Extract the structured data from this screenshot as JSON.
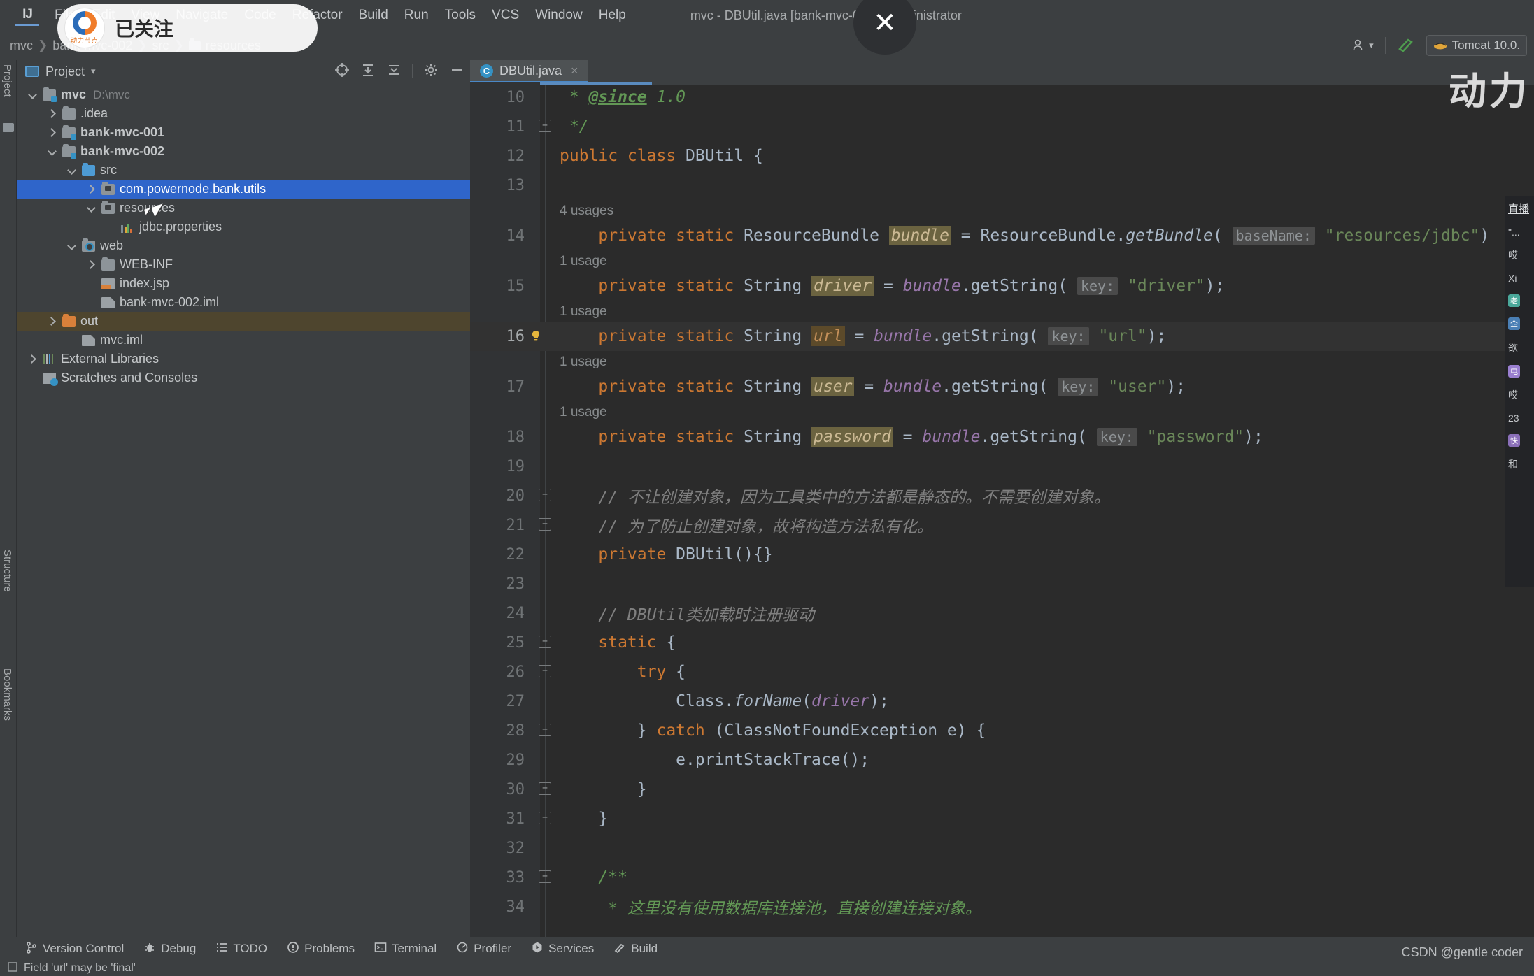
{
  "window": {
    "title": "mvc - DBUtil.java [bank-mvc-002] - Administrator",
    "logo_text": "IJ"
  },
  "menu": {
    "items": [
      "File",
      "Edit",
      "View",
      "Navigate",
      "Code",
      "Refactor",
      "Build",
      "Run",
      "Tools",
      "VCS",
      "Window",
      "Help"
    ]
  },
  "breadcrumb": {
    "items": [
      "mvc",
      "bank-mvc-002",
      "src",
      "resources"
    ]
  },
  "toolbar_right": {
    "account_icon": "user-icon",
    "hammer_icon": "build-icon",
    "run_config": "Tomcat 10.0."
  },
  "rails": {
    "left_top": "Project",
    "left_mid": "Structure",
    "left_bottom": "Bookmarks"
  },
  "project_panel": {
    "title": "Project",
    "icons": [
      "target-icon",
      "collapse-all-icon",
      "expand-icon",
      "gear-icon",
      "minimize-icon"
    ],
    "tree": [
      {
        "label": "mvc",
        "path": "D:\\mvc",
        "indent": 0,
        "arrow": "down",
        "icon": "module",
        "bold": true
      },
      {
        "label": ".idea",
        "path": "",
        "indent": 1,
        "arrow": "right",
        "icon": "folder",
        "bold": false
      },
      {
        "label": "bank-mvc-001",
        "path": "",
        "indent": 1,
        "arrow": "right",
        "icon": "module",
        "bold": true
      },
      {
        "label": "bank-mvc-002",
        "path": "",
        "indent": 1,
        "arrow": "down",
        "icon": "module",
        "bold": true
      },
      {
        "label": "src",
        "path": "",
        "indent": 2,
        "arrow": "down",
        "icon": "source",
        "bold": false
      },
      {
        "label": "com.powernode.bank.utils",
        "path": "",
        "indent": 3,
        "arrow": "right",
        "icon": "package",
        "bold": false,
        "selected": true
      },
      {
        "label": "resources",
        "path": "",
        "indent": 3,
        "arrow": "down",
        "icon": "resource",
        "bold": false
      },
      {
        "label": "jdbc.properties",
        "path": "",
        "indent": 4,
        "arrow": "none",
        "icon": "properties",
        "bold": false
      },
      {
        "label": "web",
        "path": "",
        "indent": 2,
        "arrow": "down",
        "icon": "webfolder",
        "bold": false
      },
      {
        "label": "WEB-INF",
        "path": "",
        "indent": 3,
        "arrow": "right",
        "icon": "folder",
        "bold": false
      },
      {
        "label": "index.jsp",
        "path": "",
        "indent": 3,
        "arrow": "none",
        "icon": "jsp",
        "bold": false
      },
      {
        "label": "bank-mvc-002.iml",
        "path": "",
        "indent": 3,
        "arrow": "none",
        "icon": "iml",
        "bold": false
      },
      {
        "label": "out",
        "path": "",
        "indent": 1,
        "arrow": "right",
        "icon": "out",
        "bold": false,
        "excluded": true
      },
      {
        "label": "mvc.iml",
        "path": "",
        "indent": 2,
        "arrow": "none",
        "icon": "iml",
        "bold": false
      },
      {
        "label": "External Libraries",
        "path": "",
        "indent": 0,
        "arrow": "right",
        "icon": "library",
        "bold": false
      },
      {
        "label": "Scratches and Consoles",
        "path": "",
        "indent": 0,
        "arrow": "none",
        "icon": "scratch",
        "bold": false
      }
    ]
  },
  "editor": {
    "tab": {
      "name": "DBUtil.java",
      "icon_letter": "C",
      "close": "×"
    },
    "lines": [
      {
        "num": "10",
        "fold": "",
        "segments": [
          {
            "t": " * ",
            "c": "doc"
          },
          {
            "t": "@since",
            "c": "doctag"
          },
          {
            "t": " 1.0",
            "c": "doc"
          }
        ]
      },
      {
        "num": "11",
        "fold": "minus",
        "segments": [
          {
            "t": " */",
            "c": "doc"
          }
        ]
      },
      {
        "num": "12",
        "fold": "",
        "segments": [
          {
            "t": "public class ",
            "c": "kw"
          },
          {
            "t": "DBUtil",
            "c": "cls"
          },
          {
            "t": " {",
            "c": "plain"
          }
        ]
      },
      {
        "num": "13",
        "fold": "",
        "segments": []
      },
      {
        "num": "14",
        "fold": "",
        "hint": "4 usages",
        "segments": [
          {
            "t": "    private static ",
            "c": "kw"
          },
          {
            "t": "ResourceBundle ",
            "c": "cls"
          },
          {
            "t": "bundle",
            "c": "fldhl"
          },
          {
            "t": " = ",
            "c": "plain"
          },
          {
            "t": "ResourceBundle.",
            "c": "plain"
          },
          {
            "t": "getBundle",
            "c": "mth"
          },
          {
            "t": "( ",
            "c": "plain"
          },
          {
            "t": "baseName:",
            "c": "chip"
          },
          {
            "t": " ",
            "c": "plain"
          },
          {
            "t": "\"resources/jdbc\"",
            "c": "str"
          },
          {
            "t": ")",
            "c": "plain"
          }
        ]
      },
      {
        "num": "15",
        "fold": "",
        "hint": "1 usage",
        "segments": [
          {
            "t": "    private static ",
            "c": "kw"
          },
          {
            "t": "String ",
            "c": "cls"
          },
          {
            "t": "driver",
            "c": "fldhl"
          },
          {
            "t": " = ",
            "c": "plain"
          },
          {
            "t": "bundle",
            "c": "fldn"
          },
          {
            "t": ".",
            "c": "plain"
          },
          {
            "t": "getString",
            "c": "plain"
          },
          {
            "t": "( ",
            "c": "plain"
          },
          {
            "t": "key:",
            "c": "chip"
          },
          {
            "t": " ",
            "c": "plain"
          },
          {
            "t": "\"driver\"",
            "c": "str"
          },
          {
            "t": ");",
            "c": "plain"
          }
        ]
      },
      {
        "num": "16",
        "fold": "",
        "hint": "1 usage",
        "caret": true,
        "bulb": true,
        "segments": [
          {
            "t": "    private static ",
            "c": "kw"
          },
          {
            "t": "String ",
            "c": "cls"
          },
          {
            "t": "url",
            "c": "fldhl2"
          },
          {
            "t": " = ",
            "c": "plain"
          },
          {
            "t": "bundle",
            "c": "fldn"
          },
          {
            "t": ".",
            "c": "plain"
          },
          {
            "t": "getString",
            "c": "plain"
          },
          {
            "t": "( ",
            "c": "plain"
          },
          {
            "t": "key:",
            "c": "chip"
          },
          {
            "t": " ",
            "c": "plain"
          },
          {
            "t": "\"url\"",
            "c": "str"
          },
          {
            "t": ");",
            "c": "plain"
          }
        ]
      },
      {
        "num": "17",
        "fold": "",
        "hint": "1 usage",
        "segments": [
          {
            "t": "    private static ",
            "c": "kw"
          },
          {
            "t": "String ",
            "c": "cls"
          },
          {
            "t": "user",
            "c": "fldhl"
          },
          {
            "t": " = ",
            "c": "plain"
          },
          {
            "t": "bundle",
            "c": "fldn"
          },
          {
            "t": ".",
            "c": "plain"
          },
          {
            "t": "getString",
            "c": "plain"
          },
          {
            "t": "( ",
            "c": "plain"
          },
          {
            "t": "key:",
            "c": "chip"
          },
          {
            "t": " ",
            "c": "plain"
          },
          {
            "t": "\"user\"",
            "c": "str"
          },
          {
            "t": ");",
            "c": "plain"
          }
        ]
      },
      {
        "num": "18",
        "fold": "",
        "hint": "1 usage",
        "segments": [
          {
            "t": "    private static ",
            "c": "kw"
          },
          {
            "t": "String ",
            "c": "cls"
          },
          {
            "t": "password",
            "c": "fldhl"
          },
          {
            "t": " = ",
            "c": "plain"
          },
          {
            "t": "bundle",
            "c": "fldn"
          },
          {
            "t": ".",
            "c": "plain"
          },
          {
            "t": "getString",
            "c": "plain"
          },
          {
            "t": "( ",
            "c": "plain"
          },
          {
            "t": "key:",
            "c": "chip"
          },
          {
            "t": " ",
            "c": "plain"
          },
          {
            "t": "\"password\"",
            "c": "str"
          },
          {
            "t": ");",
            "c": "plain"
          }
        ]
      },
      {
        "num": "19",
        "fold": "",
        "segments": []
      },
      {
        "num": "20",
        "fold": "minus",
        "segments": [
          {
            "t": "    // 不让创建对象，因为工具类中的方法都是静态的。不需要创建对象。",
            "c": "cmt"
          }
        ]
      },
      {
        "num": "21",
        "fold": "minus2",
        "segments": [
          {
            "t": "    // 为了防止创建对象，故将构造方法私有化。",
            "c": "cmt"
          }
        ]
      },
      {
        "num": "22",
        "fold": "",
        "segments": [
          {
            "t": "    private ",
            "c": "kw"
          },
          {
            "t": "DBUtil",
            "c": "cls"
          },
          {
            "t": "(){}",
            "c": "plain"
          }
        ]
      },
      {
        "num": "23",
        "fold": "",
        "segments": []
      },
      {
        "num": "24",
        "fold": "",
        "segments": [
          {
            "t": "    // DBUtil类加载时注册驱动",
            "c": "cmt"
          }
        ]
      },
      {
        "num": "25",
        "fold": "minus",
        "segments": [
          {
            "t": "    static ",
            "c": "kw"
          },
          {
            "t": "{",
            "c": "plain"
          }
        ]
      },
      {
        "num": "26",
        "fold": "minus",
        "segments": [
          {
            "t": "        try ",
            "c": "kw"
          },
          {
            "t": "{",
            "c": "plain"
          }
        ]
      },
      {
        "num": "27",
        "fold": "",
        "segments": [
          {
            "t": "            Class.",
            "c": "plain"
          },
          {
            "t": "forName",
            "c": "mth"
          },
          {
            "t": "(",
            "c": "plain"
          },
          {
            "t": "driver",
            "c": "fldn"
          },
          {
            "t": ");",
            "c": "plain"
          }
        ]
      },
      {
        "num": "28",
        "fold": "minus2",
        "segments": [
          {
            "t": "        } ",
            "c": "plain"
          },
          {
            "t": "catch ",
            "c": "kw"
          },
          {
            "t": "(ClassNotFoundException e) {",
            "c": "plain"
          }
        ]
      },
      {
        "num": "29",
        "fold": "",
        "segments": [
          {
            "t": "            e.printStackTrace();",
            "c": "plain"
          }
        ]
      },
      {
        "num": "30",
        "fold": "minus2",
        "segments": [
          {
            "t": "        }",
            "c": "plain"
          }
        ]
      },
      {
        "num": "31",
        "fold": "minus2",
        "segments": [
          {
            "t": "    }",
            "c": "plain"
          }
        ]
      },
      {
        "num": "32",
        "fold": "",
        "segments": []
      },
      {
        "num": "33",
        "fold": "minus",
        "segments": [
          {
            "t": "    /**",
            "c": "doc"
          }
        ]
      },
      {
        "num": "34",
        "fold": "",
        "segments": [
          {
            "t": "     * 这里没有使用数据库连接池，直接创建连接对象。",
            "c": "doc"
          }
        ]
      }
    ]
  },
  "toolwindows": {
    "items": [
      {
        "label": "Version Control",
        "icon": "branch-icon"
      },
      {
        "label": "Debug",
        "icon": "bug-icon"
      },
      {
        "label": "TODO",
        "icon": "list-icon"
      },
      {
        "label": "Problems",
        "icon": "warning-icon"
      },
      {
        "label": "Terminal",
        "icon": "terminal-icon"
      },
      {
        "label": "Profiler",
        "icon": "profiler-icon"
      },
      {
        "label": "Services",
        "icon": "services-icon"
      },
      {
        "label": "Build",
        "icon": "hammer-icon"
      }
    ]
  },
  "statusbar": {
    "message": "Field 'url' may be 'final'"
  },
  "overlays": {
    "follow_badge": "已关注",
    "brand_sub": "动力节点",
    "close_glyph": "✕",
    "big_watermark": "动力",
    "csdn": "CSDN @gentle coder",
    "chat": {
      "title": "直播",
      "rows": [
        "\"...",
        "哎",
        "Xi",
        "老",
        "企",
        "欲",
        "电",
        "哎",
        "23",
        "快",
        "和"
      ]
    }
  },
  "colors": {
    "accent": "#3592c4",
    "selection": "#2f65ca",
    "excluded": "#4e452e",
    "editor_bg": "#2b2b2b",
    "panel_bg": "#3c3f41",
    "keyword": "#cc7832",
    "string": "#6a8759",
    "comment": "#808080",
    "javadoc": "#629755",
    "field": "#9876aa"
  }
}
